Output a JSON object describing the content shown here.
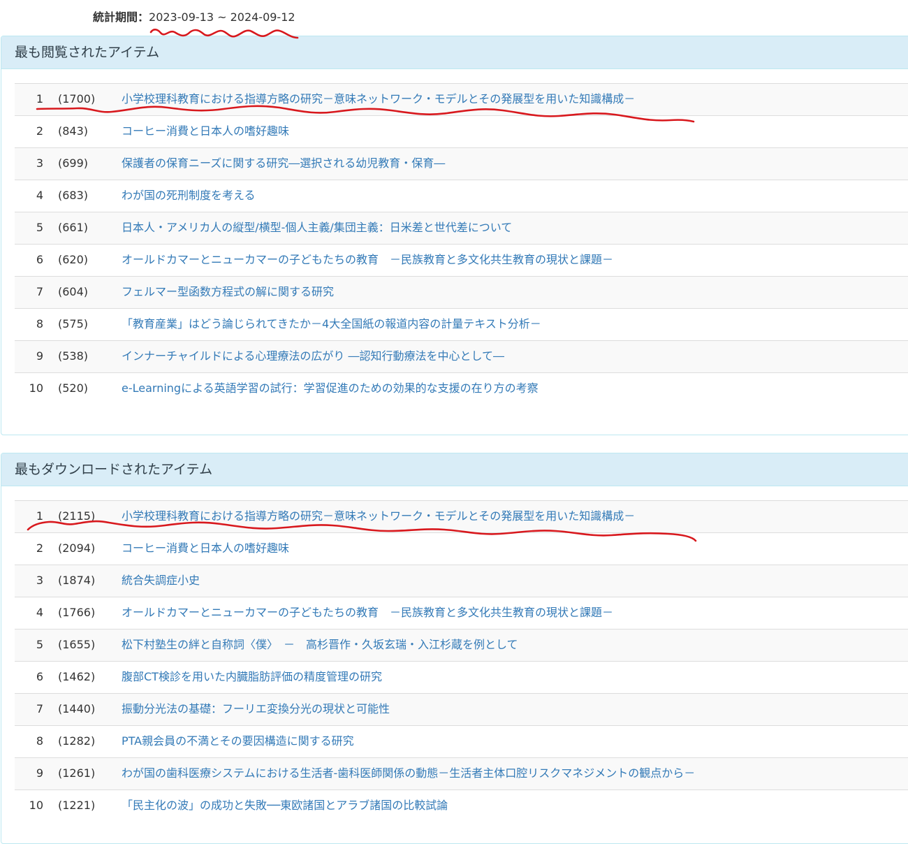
{
  "period": {
    "label": "統計期間：",
    "value": "2023-09-13 ~ 2024-09-12"
  },
  "most_viewed": {
    "heading": "最も閲覧されたアイテム",
    "items": [
      {
        "rank": "1",
        "count": "(1700)",
        "title": "小学校理科教育における指導方略の研究－意味ネットワーク・モデルとその発展型を用いた知識構成－"
      },
      {
        "rank": "2",
        "count": "(843)",
        "title": "コーヒー消費と日本人の嗜好趣味"
      },
      {
        "rank": "3",
        "count": "(699)",
        "title": "保護者の保育ニーズに関する研究―選択される幼児教育・保育―"
      },
      {
        "rank": "4",
        "count": "(683)",
        "title": "わが国の死刑制度を考える"
      },
      {
        "rank": "5",
        "count": "(661)",
        "title": "日本人・アメリカ人の縦型/横型-個人主義/集団主義：日米差と世代差について"
      },
      {
        "rank": "6",
        "count": "(620)",
        "title": "オールドカマーとニューカマーの子どもたちの教育　－民族教育と多文化共生教育の現状と課題－"
      },
      {
        "rank": "7",
        "count": "(604)",
        "title": "フェルマー型函数方程式の解に関する研究"
      },
      {
        "rank": "8",
        "count": "(575)",
        "title": "「教育産業」はどう論じられてきたか－4大全国紙の報道内容の計量テキスト分析－"
      },
      {
        "rank": "9",
        "count": "(538)",
        "title": "インナーチャイルドによる心理療法の広がり ―認知行動療法を中心として―"
      },
      {
        "rank": "10",
        "count": "(520)",
        "title": "e-Learningによる英語学習の試行：学習促進のための効果的な支援の在り方の考察"
      }
    ]
  },
  "most_downloaded": {
    "heading": "最もダウンロードされたアイテム",
    "items": [
      {
        "rank": "1",
        "count": "(2115)",
        "title": "小学校理科教育における指導方略の研究－意味ネットワーク・モデルとその発展型を用いた知識構成－"
      },
      {
        "rank": "2",
        "count": "(2094)",
        "title": "コーヒー消費と日本人の嗜好趣味"
      },
      {
        "rank": "3",
        "count": "(1874)",
        "title": "統合失調症小史"
      },
      {
        "rank": "4",
        "count": "(1766)",
        "title": "オールドカマーとニューカマーの子どもたちの教育　－民族教育と多文化共生教育の現状と課題－"
      },
      {
        "rank": "5",
        "count": "(1655)",
        "title": "松下村塾生の絆と自称詞〈僕〉　－　高杉晋作・久坂玄瑞・入江杉蔵を例として"
      },
      {
        "rank": "6",
        "count": "(1462)",
        "title": "腹部CT検診を用いた内臓脂肪評価の精度管理の研究"
      },
      {
        "rank": "7",
        "count": "(1440)",
        "title": "振動分光法の基礎：フーリエ変換分光の現状と可能性"
      },
      {
        "rank": "8",
        "count": "(1282)",
        "title": "PTA親会員の不満とその要因構造に関する研究"
      },
      {
        "rank": "9",
        "count": "(1261)",
        "title": "わが国の歯科医療システムにおける生活者-歯科医師関係の動態－生活者主体口腔リスクマネジメントの観点から－"
      },
      {
        "rank": "10",
        "count": "(1221)",
        "title": "「民主化の波」の成功と失敗──東欧諸国とアラブ諸国の比較試論"
      }
    ]
  },
  "annotation_color": "#d8181d"
}
